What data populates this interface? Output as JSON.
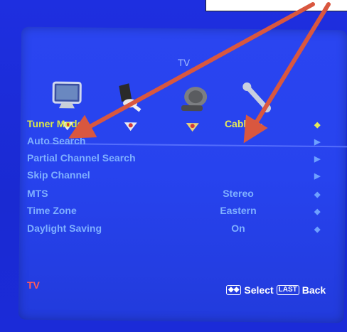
{
  "menu": {
    "title": "TV",
    "categories": [
      {
        "icon": "tv-monitor-icon"
      },
      {
        "icon": "speaker-icon"
      },
      {
        "icon": "satellite-dish-icon"
      },
      {
        "icon": "wrench-icon"
      }
    ],
    "rows": [
      {
        "label": "Tuner Mode",
        "value": "Cable",
        "control": "left-right-arrows"
      },
      {
        "label": "Auto Search",
        "value": "",
        "control": "right-arrow"
      },
      {
        "label": "Partial Channel Search",
        "value": "",
        "control": "right-arrow"
      },
      {
        "label": "Skip Channel",
        "value": "",
        "control": "right-arrow"
      },
      {
        "label": "MTS",
        "value": "Stereo",
        "control": "left-right-arrows"
      },
      {
        "label": "Time Zone",
        "value": "Eastern",
        "control": "left-right-arrows"
      },
      {
        "label": "Daylight Saving",
        "value": "On",
        "control": "left-right-arrows"
      }
    ]
  },
  "footer": {
    "left": "TV",
    "select_label": "Select",
    "last_key": "LAST",
    "back_label": "Back"
  },
  "colors": {
    "background": "#1c2bd6",
    "panel": "#2743ee",
    "highlight": "#d9e64a",
    "item_text": "#7fb0ff",
    "annotation_arrow": "#d9573f"
  }
}
